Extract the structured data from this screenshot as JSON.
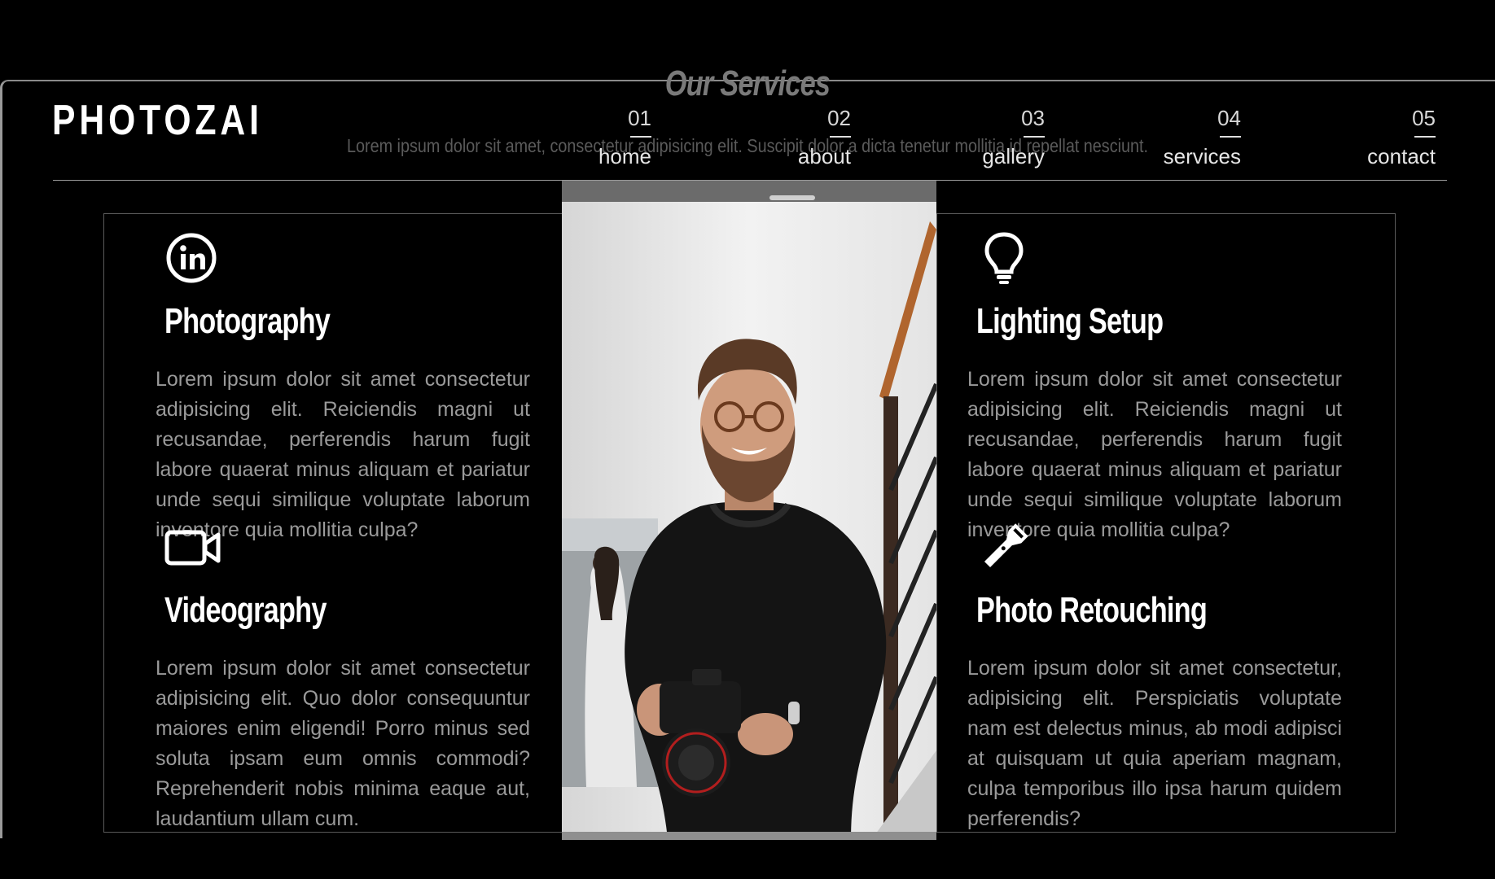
{
  "section": {
    "title": "Our Services",
    "subtitle": "Lorem ipsum dolor sit amet, consectetur adipisicing elit. Suscipit dolor a dicta tenetur mollitia id repellat nesciunt."
  },
  "brand": {
    "logo": "PHOTOZAI"
  },
  "nav": [
    {
      "num": "01",
      "label": "home"
    },
    {
      "num": "02",
      "label": "about"
    },
    {
      "num": "03",
      "label": "gallery"
    },
    {
      "num": "04",
      "label": "services"
    },
    {
      "num": "05",
      "label": "contact"
    }
  ],
  "services": [
    {
      "title": "Photography",
      "icon": "linkedin-icon",
      "text": "Lorem ipsum dolor sit amet consectetur adipisicing elit. Reiciendis magni ut recusandae, perferendis harum fugit labore quaerat minus aliquam et pariatur unde sequi similique voluptate laborum inventore quia mollitia culpa?"
    },
    {
      "title": "Videography",
      "icon": "video-camera-icon",
      "text": "Lorem ipsum dolor sit amet consectetur adipisicing elit. Quo dolor consequuntur maiores enim eligendi! Porro minus sed soluta ipsam eum omnis commodi? Reprehenderit nobis minima eaque aut, laudantium ullam cum."
    },
    {
      "title": "Lighting Setup",
      "icon": "lightbulb-icon",
      "text": "Lorem ipsum dolor sit amet consectetur adipisicing elit. Reiciendis magni ut recusandae, perferendis harum fugit labore quaerat minus aliquam et pariatur unde sequi similique voluptate laborum inventore quia mollitia culpa?"
    },
    {
      "title": "Photo Retouching",
      "icon": "flashlight-icon",
      "text": "Lorem ipsum dolor sit amet consectetur, adipisicing elit. Perspiciatis voluptate nam est delectus minus, ab modi adipisci at quisquam ut quia aperiam magnam, culpa temporibus illo ipsa harum quidem perferendis?"
    }
  ],
  "colors": {
    "background": "#000000",
    "text": "#ffffff",
    "muted_text": "#9a9a9a",
    "card_border": "#5a5a5a"
  }
}
